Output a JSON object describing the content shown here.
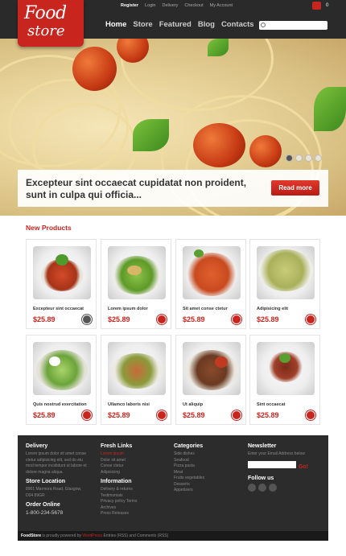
{
  "logo": {
    "line1": "Food",
    "line2": "store"
  },
  "toplinks": [
    "Register",
    "Login",
    "Delivery",
    "Checkout",
    "My Account"
  ],
  "cart": {
    "count": "0"
  },
  "nav": [
    "Home",
    "Store",
    "Featured",
    "Blog",
    "Contacts"
  ],
  "banner": {
    "text": "Excepteur sint occaecat cupidatat non proident, sunt in culpa qui officia...",
    "button": "Read more"
  },
  "products": {
    "title": "New Products",
    "items": [
      {
        "name": "Excepteur sint occaecat",
        "price": "$25.89"
      },
      {
        "name": "Lorem ipsum dolor",
        "price": "$25.89"
      },
      {
        "name": "Sit amet conse ctetur",
        "price": "$25.89"
      },
      {
        "name": "Adipisicing elit",
        "price": "$25.89"
      },
      {
        "name": "Quis nostrud exercitation",
        "price": "$25.89"
      },
      {
        "name": "Ullamco laboris nisi",
        "price": "$25.89"
      },
      {
        "name": "Ut aliquip",
        "price": "$25.89"
      },
      {
        "name": "Sint occaecat",
        "price": "$25.89"
      }
    ]
  },
  "footer": {
    "delivery": {
      "title": "Delivery",
      "text": [
        "Lorem ipsum dolor sit amet conse",
        "ctetur adipisicing elit, sed do eiu",
        "mod tempor incididunt ut labore et",
        "dolore magna aliqua."
      ]
    },
    "store_location": {
      "title": "Store Location",
      "lines": [
        "8901 Marmora Road, Glasgow,",
        "D04 89GR"
      ]
    },
    "order_online": {
      "title": "Order Online",
      "phone": "1-800-234-5678"
    },
    "fresh_links": {
      "title": "Fresh Links",
      "items": [
        "Lorem ipsum",
        "Dolor sit amet",
        "Conse ctetur",
        "Adipisicing"
      ]
    },
    "information": {
      "title": "Information",
      "items": [
        "Delivery & returns",
        "Testimonials",
        "Privacy policy Terms",
        "Archives",
        "Press Releases"
      ]
    },
    "categories": {
      "title": "Categories",
      "items": [
        "Side dishes",
        "Seafood",
        "Pizza pasta",
        "Meat",
        "Fruits vegetables",
        "Desserts",
        "Appetizers"
      ]
    },
    "newsletter": {
      "title": "Newsletter",
      "prompt": "Enter your Email Address below",
      "go": "Go!"
    },
    "follow": {
      "title": "Follow us"
    }
  },
  "bottombar": {
    "brand": "FoodStore",
    "text1": "is proudly powered by",
    "wp": "WordPress",
    "text2": "Entries (RSS) and Comments (RSS)"
  }
}
